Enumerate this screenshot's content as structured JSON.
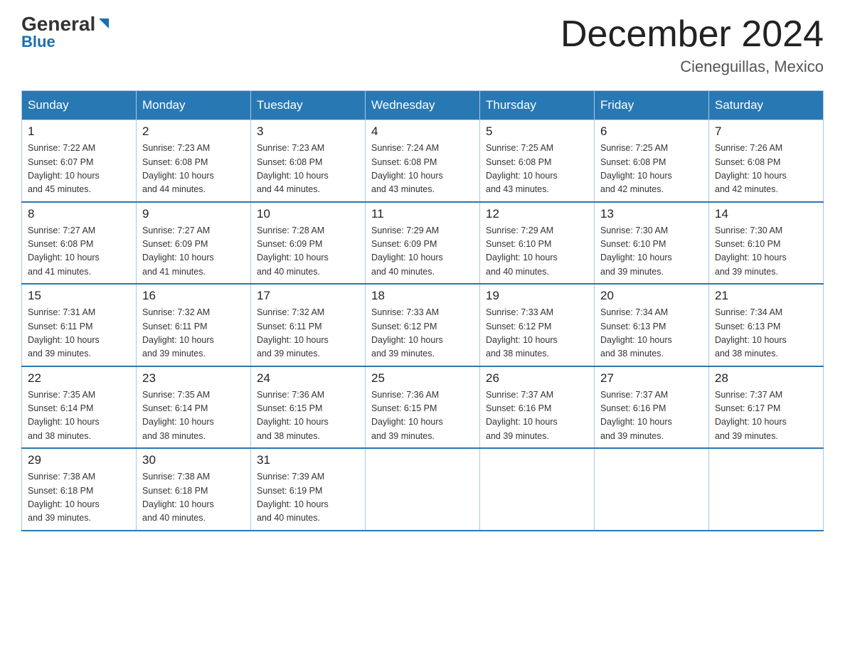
{
  "logo": {
    "part1": "General",
    "part2": "Blue"
  },
  "header": {
    "title": "December 2024",
    "location": "Cieneguillas, Mexico"
  },
  "days_of_week": [
    "Sunday",
    "Monday",
    "Tuesday",
    "Wednesday",
    "Thursday",
    "Friday",
    "Saturday"
  ],
  "weeks": [
    [
      {
        "day": "1",
        "sunrise": "7:22 AM",
        "sunset": "6:07 PM",
        "daylight": "10 hours and 45 minutes."
      },
      {
        "day": "2",
        "sunrise": "7:23 AM",
        "sunset": "6:08 PM",
        "daylight": "10 hours and 44 minutes."
      },
      {
        "day": "3",
        "sunrise": "7:23 AM",
        "sunset": "6:08 PM",
        "daylight": "10 hours and 44 minutes."
      },
      {
        "day": "4",
        "sunrise": "7:24 AM",
        "sunset": "6:08 PM",
        "daylight": "10 hours and 43 minutes."
      },
      {
        "day": "5",
        "sunrise": "7:25 AM",
        "sunset": "6:08 PM",
        "daylight": "10 hours and 43 minutes."
      },
      {
        "day": "6",
        "sunrise": "7:25 AM",
        "sunset": "6:08 PM",
        "daylight": "10 hours and 42 minutes."
      },
      {
        "day": "7",
        "sunrise": "7:26 AM",
        "sunset": "6:08 PM",
        "daylight": "10 hours and 42 minutes."
      }
    ],
    [
      {
        "day": "8",
        "sunrise": "7:27 AM",
        "sunset": "6:08 PM",
        "daylight": "10 hours and 41 minutes."
      },
      {
        "day": "9",
        "sunrise": "7:27 AM",
        "sunset": "6:09 PM",
        "daylight": "10 hours and 41 minutes."
      },
      {
        "day": "10",
        "sunrise": "7:28 AM",
        "sunset": "6:09 PM",
        "daylight": "10 hours and 40 minutes."
      },
      {
        "day": "11",
        "sunrise": "7:29 AM",
        "sunset": "6:09 PM",
        "daylight": "10 hours and 40 minutes."
      },
      {
        "day": "12",
        "sunrise": "7:29 AM",
        "sunset": "6:10 PM",
        "daylight": "10 hours and 40 minutes."
      },
      {
        "day": "13",
        "sunrise": "7:30 AM",
        "sunset": "6:10 PM",
        "daylight": "10 hours and 39 minutes."
      },
      {
        "day": "14",
        "sunrise": "7:30 AM",
        "sunset": "6:10 PM",
        "daylight": "10 hours and 39 minutes."
      }
    ],
    [
      {
        "day": "15",
        "sunrise": "7:31 AM",
        "sunset": "6:11 PM",
        "daylight": "10 hours and 39 minutes."
      },
      {
        "day": "16",
        "sunrise": "7:32 AM",
        "sunset": "6:11 PM",
        "daylight": "10 hours and 39 minutes."
      },
      {
        "day": "17",
        "sunrise": "7:32 AM",
        "sunset": "6:11 PM",
        "daylight": "10 hours and 39 minutes."
      },
      {
        "day": "18",
        "sunrise": "7:33 AM",
        "sunset": "6:12 PM",
        "daylight": "10 hours and 39 minutes."
      },
      {
        "day": "19",
        "sunrise": "7:33 AM",
        "sunset": "6:12 PM",
        "daylight": "10 hours and 38 minutes."
      },
      {
        "day": "20",
        "sunrise": "7:34 AM",
        "sunset": "6:13 PM",
        "daylight": "10 hours and 38 minutes."
      },
      {
        "day": "21",
        "sunrise": "7:34 AM",
        "sunset": "6:13 PM",
        "daylight": "10 hours and 38 minutes."
      }
    ],
    [
      {
        "day": "22",
        "sunrise": "7:35 AM",
        "sunset": "6:14 PM",
        "daylight": "10 hours and 38 minutes."
      },
      {
        "day": "23",
        "sunrise": "7:35 AM",
        "sunset": "6:14 PM",
        "daylight": "10 hours and 38 minutes."
      },
      {
        "day": "24",
        "sunrise": "7:36 AM",
        "sunset": "6:15 PM",
        "daylight": "10 hours and 38 minutes."
      },
      {
        "day": "25",
        "sunrise": "7:36 AM",
        "sunset": "6:15 PM",
        "daylight": "10 hours and 39 minutes."
      },
      {
        "day": "26",
        "sunrise": "7:37 AM",
        "sunset": "6:16 PM",
        "daylight": "10 hours and 39 minutes."
      },
      {
        "day": "27",
        "sunrise": "7:37 AM",
        "sunset": "6:16 PM",
        "daylight": "10 hours and 39 minutes."
      },
      {
        "day": "28",
        "sunrise": "7:37 AM",
        "sunset": "6:17 PM",
        "daylight": "10 hours and 39 minutes."
      }
    ],
    [
      {
        "day": "29",
        "sunrise": "7:38 AM",
        "sunset": "6:18 PM",
        "daylight": "10 hours and 39 minutes."
      },
      {
        "day": "30",
        "sunrise": "7:38 AM",
        "sunset": "6:18 PM",
        "daylight": "10 hours and 40 minutes."
      },
      {
        "day": "31",
        "sunrise": "7:39 AM",
        "sunset": "6:19 PM",
        "daylight": "10 hours and 40 minutes."
      },
      null,
      null,
      null,
      null
    ]
  ],
  "labels": {
    "sunrise": "Sunrise:",
    "sunset": "Sunset:",
    "daylight": "Daylight:"
  }
}
